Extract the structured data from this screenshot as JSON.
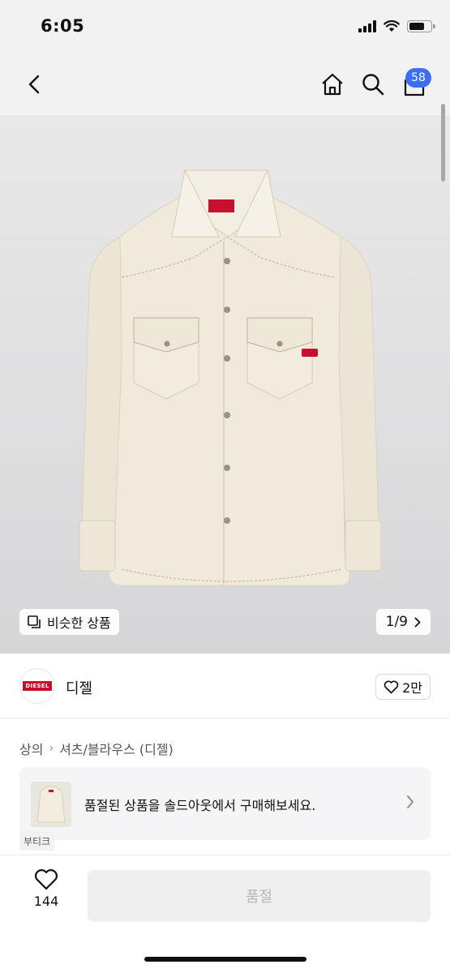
{
  "status_bar": {
    "time": "6:05"
  },
  "nav": {
    "cart_count": "58"
  },
  "gallery": {
    "similar_label": "비슷한 상품",
    "page_indicator": "1/9"
  },
  "brand": {
    "logo_text": "DIESEL",
    "name": "디젤",
    "like_count": "2만"
  },
  "breadcrumb": {
    "items": [
      "상의",
      "셔츠/블라우스 (디젤)"
    ]
  },
  "soldout_banner": {
    "text": "품절된 상품을 솔드아웃에서 구매해보세요.",
    "boutique_label": "부티크"
  },
  "bottom": {
    "wish_count": "144",
    "buy_label": "품절"
  },
  "colors": {
    "accent": "#3b6ef5",
    "diesel_red": "#c8102e",
    "shirt": "#f0eadc"
  }
}
